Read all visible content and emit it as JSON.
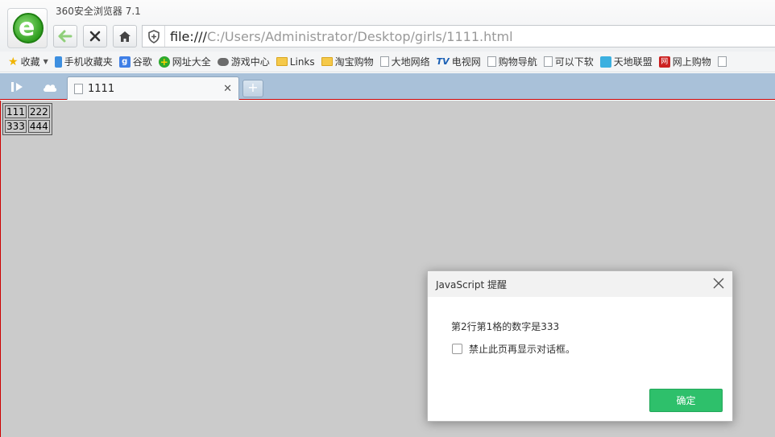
{
  "window": {
    "title": "360安全浏览器 7.1"
  },
  "toolbar": {
    "url_protocol": "file:///",
    "url_path": "C:/Users/Administrator/Desktop/girls/1111.html"
  },
  "bookmarks": {
    "favorites_label": "收藏",
    "items": [
      {
        "label": "手机收藏夹",
        "icon": "phone-icon"
      },
      {
        "label": "谷歌",
        "icon": "google-icon"
      },
      {
        "label": "网址大全",
        "icon": "site-directory-icon"
      },
      {
        "label": "游戏中心",
        "icon": "gamepad-icon"
      },
      {
        "label": "Links",
        "icon": "folder-icon"
      },
      {
        "label": "淘宝购物",
        "icon": "folder-icon"
      },
      {
        "label": "大地网络",
        "icon": "page-icon"
      },
      {
        "label": "电视网",
        "icon": "tv-icon"
      },
      {
        "label": "购物导航",
        "icon": "page-icon"
      },
      {
        "label": "可以下软",
        "icon": "page-icon"
      },
      {
        "label": "天地联盟",
        "icon": "tiandi-icon"
      },
      {
        "label": "网上购物",
        "icon": "shopping-icon"
      }
    ]
  },
  "tabs": [
    {
      "label": "1111",
      "active": true
    }
  ],
  "page": {
    "table": [
      [
        "111",
        "222"
      ],
      [
        "333",
        "444"
      ]
    ]
  },
  "dialog": {
    "title": "JavaScript 提醒",
    "message": "第2行第1格的数字是333",
    "checkbox_label": "禁止此页再显示对话框。",
    "ok_label": "确定"
  },
  "colors": {
    "accent_green": "#2ec06b",
    "tabstrip_blue": "#a9c1d9",
    "page_bg": "#cbcbcb"
  }
}
